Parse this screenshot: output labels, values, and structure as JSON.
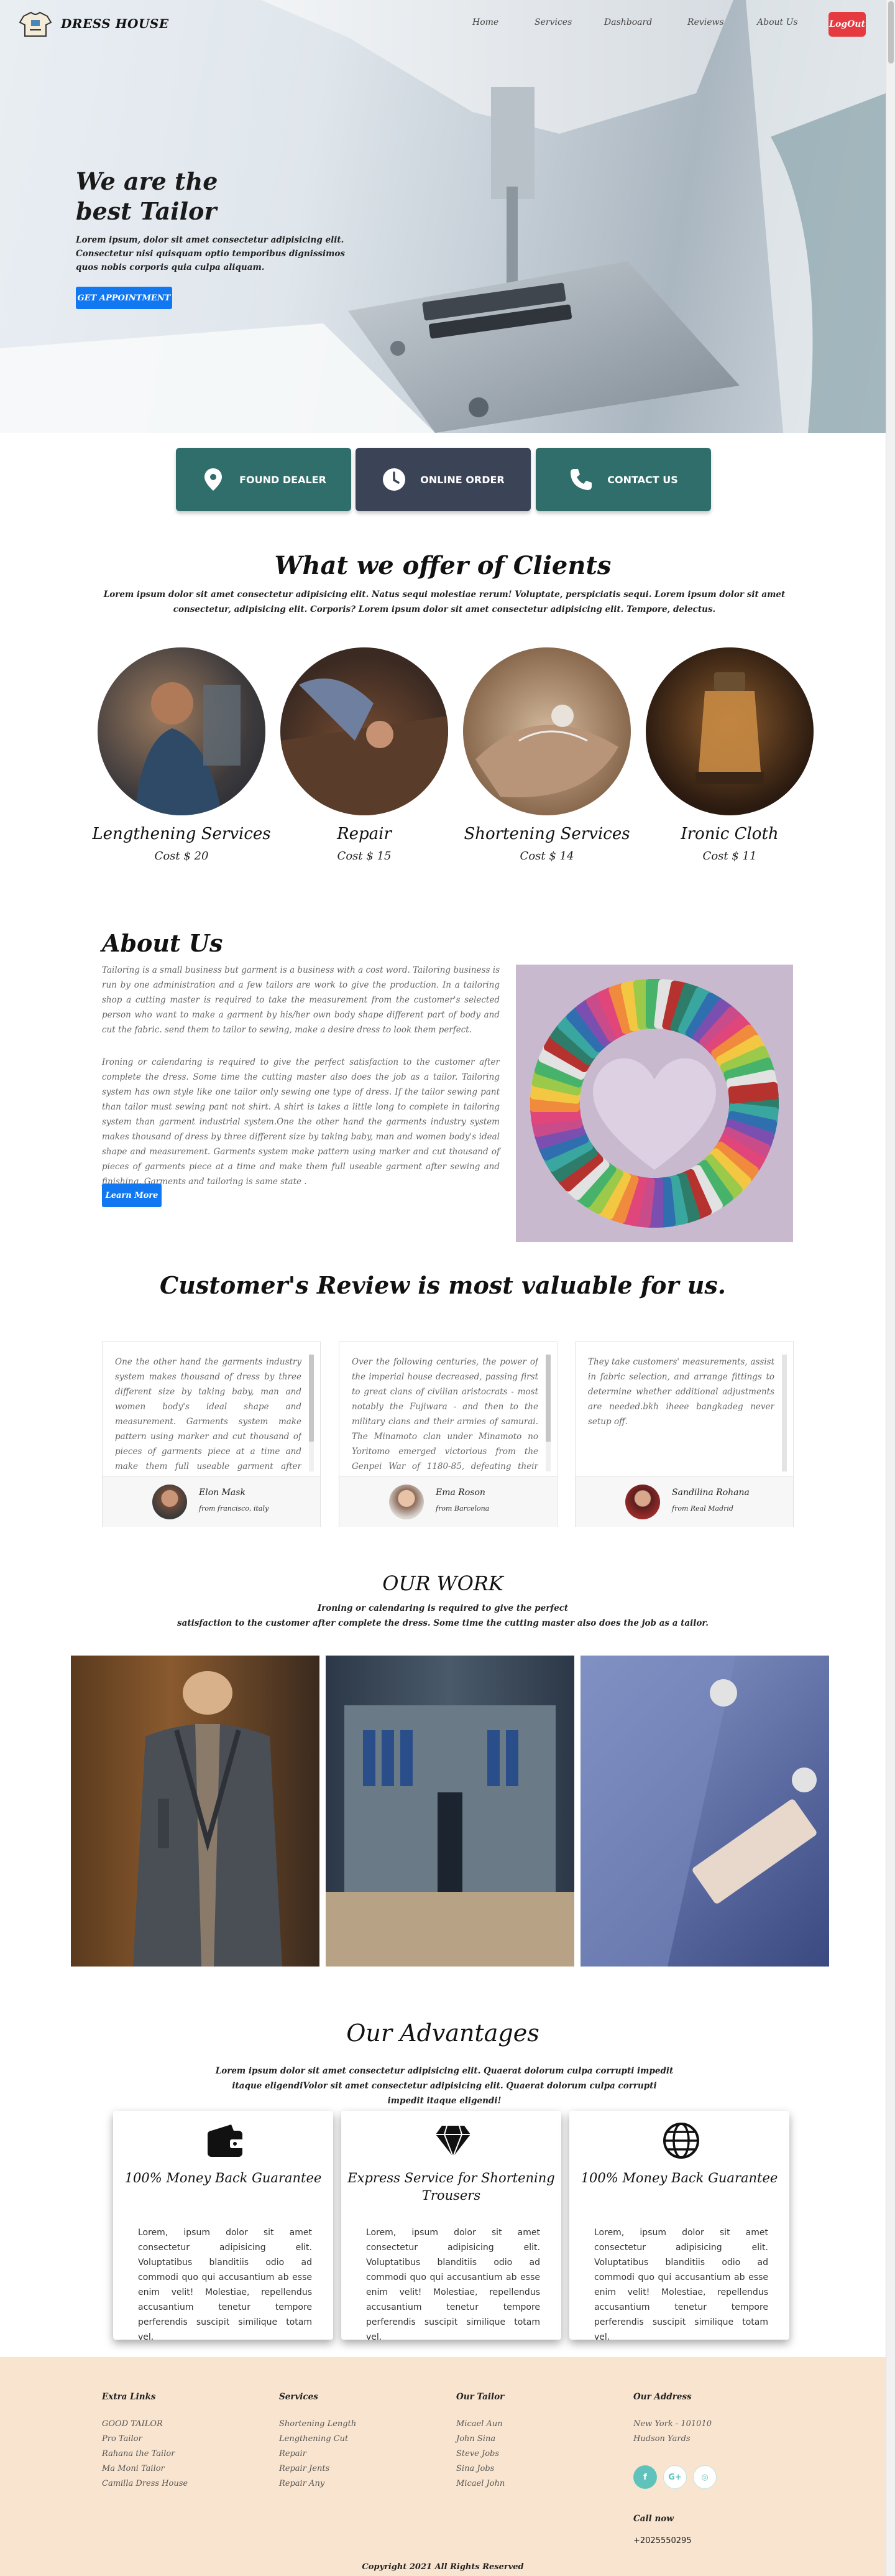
{
  "nav": {
    "brand": "DRESS HOUSE",
    "links": [
      "Home",
      "Services",
      "Dashboard",
      "Reviews",
      "About Us"
    ],
    "logout": "LogOut"
  },
  "hero": {
    "title": "We are the best Tailor",
    "text": "Lorem ipsum, dolor sit amet consectetur adipisicing elit. Consectetur nisi quisquam optio temporibus dignissimos quos nobis corporis quia culpa aliquam.",
    "button": "GET APPOINTMENT"
  },
  "service_buttons": [
    {
      "label": "FOUND DEALER",
      "icon": "map-pin-icon"
    },
    {
      "label": "ONLINE ORDER",
      "icon": "clock-icon"
    },
    {
      "label": "CONTACT US",
      "icon": "phone-icon"
    }
  ],
  "offer": {
    "title": "What we offer of Clients",
    "subtitle": "Lorem ipsum dolor sit amet consectetur adipisicing elit. Natus sequi molestiae rerum! Voluptate, perspiciatis sequi. Lorem ipsum dolor sit amet consectetur, adipisicing elit. Corporis? Lorem ipsum dolor sit amet consectetur adipisicing elit. Tempore, delectus.",
    "items": [
      {
        "name": "Lengthening Services",
        "cost": "Cost $ 20"
      },
      {
        "name": "Repair",
        "cost": "Cost $ 15"
      },
      {
        "name": "Shortening Services",
        "cost": "Cost $ 14"
      },
      {
        "name": "Ironic Cloth",
        "cost": "Cost $ 11"
      }
    ]
  },
  "about": {
    "title": "About Us",
    "p1": "Tailoring is a small business but garment is a business with a cost word. Tailoring business is run by one administration and a few tailors are work to give the production. In a tailoring shop a cutting master is required to take the measurement from the customer's selected person who want to make a garment by his/her own body shape different part of body and cut the fabric. send them to tailor to sewing, make a desire dress to look them perfect.",
    "p2": "Ironing or calendaring is required to give the perfect satisfaction to the customer after complete the dress. Some time the cutting master also does the job as a tailor. Tailoring system has own style like one tailor only sewing one type of dress. If the tailor sewing pant than tailor must sewing pant not shirt. A shirt is takes a little long to complete in tailoring system than garment industrial system.One the other hand the garments industry system makes thousand of dress by three different size by taking baby, man and women body's ideal shape and measurement. Garments system make pattern using marker and cut thousand of pieces of garments piece at a time and make them full useable garment after sewing and finishing. Garments and tailoring is same state .",
    "button": "Learn More"
  },
  "reviews": {
    "title": "Customer's Review is most valuable for us.",
    "items": [
      {
        "text": "One the other hand the garments industry system makes thousand of dress by three different size by taking baby, man and women body's ideal shape and measurement. Garments system make pattern using marker and cut thousand of pieces of garments piece at a time and make them full useable garment after sewing and finishing. Garments and tailoring is same state.",
        "name": "Elon Mask",
        "place": "from francisco, italy"
      },
      {
        "text": "Over the following centuries, the power of the imperial house decreased, passing first to great clans of civilian aristocrats - most notably the Fujiwara - and then to the military clans and their armies of samurai. The Minamoto clan under Minamoto no Yoritomo emerged victorious from the Genpei War of 1180-85, defeating their rival military clan, the Taira.",
        "name": "Ema Roson",
        "place": "from Barcelona"
      },
      {
        "text": "They take customers' measurements, assist in fabric selection, and arrange fittings to determine whether additional adjustments are needed.bkh iheee bangkadeg never setup off.",
        "name": "Sandilina Rohana",
        "place": "from Real Madrid"
      }
    ]
  },
  "work": {
    "title": "OUR WORK",
    "line1": "Ironing or calendaring is required to give the perfect",
    "line2": "satisfaction to the customer after complete the dress. Some time the cutting master also does the job as a tailor."
  },
  "advantages": {
    "title": "Our Advantages",
    "subtitle": "Lorem ipsum dolor sit amet consectetur adipisicing elit. Quaerat dolorum culpa corrupti impedit itaque eligendiVolor sit amet consectetur adipisicing elit. Quaerat dolorum culpa corrupti impedit itaque eligendi!",
    "items": [
      {
        "title": "100% Money Back Guarantee",
        "icon": "wallet-icon",
        "text": "Lorem, ipsum dolor sit amet consectetur adipisicing elit. Voluptatibus blanditiis odio ad commodi quo qui accusantium ab esse enim velit! Molestiae, repellendus accusantium tenetur tempore perferendis suscipit similique totam vel."
      },
      {
        "title": "Express Service for Shortening Trousers",
        "icon": "diamond-icon",
        "text": "Lorem, ipsum dolor sit amet consectetur adipisicing elit. Voluptatibus blanditiis odio ad commodi quo qui accusantium ab esse enim velit! Molestiae, repellendus accusantium tenetur tempore perferendis suscipit similique totam vel."
      },
      {
        "title": "100% Money Back Guarantee",
        "icon": "globe-icon",
        "text": "Lorem, ipsum dolor sit amet consectetur adipisicing elit. Voluptatibus blanditiis odio ad commodi quo qui accusantium ab esse enim velit! Molestiae, repellendus accusantium tenetur tempore perferendis suscipit similique totam vel."
      }
    ]
  },
  "footer": {
    "cols": [
      {
        "heading": "Extra Links",
        "items": [
          "GOOD TAILOR",
          "Pro Tailor",
          "Rahana the Tailor",
          "Ma Moni Tailor",
          "Camilla Dress House"
        ]
      },
      {
        "heading": "Services",
        "items": [
          "Shortening Length",
          "Lengthening Cut",
          "Repair",
          "Repair Jents",
          "Repair Any"
        ]
      },
      {
        "heading": "Our Tailor",
        "items": [
          "Micael Aun",
          "John Sina",
          "Steve Jobs",
          "Sina Jobs",
          "Micael John"
        ]
      }
    ],
    "address_heading": "Our Address",
    "address": "New York - 101010 Hudson Yards",
    "social": [
      "f",
      "G+",
      "◎"
    ],
    "call_heading": "Call now",
    "phone": "+2025550295",
    "copyright": "Copyright 2021 All Rights Reserved"
  },
  "colors": {
    "accent": "#1178f2",
    "logout": "#e53a3f",
    "teal": "#2f6e6b",
    "navy": "#3b4357",
    "footer": "#f9e5cf"
  }
}
